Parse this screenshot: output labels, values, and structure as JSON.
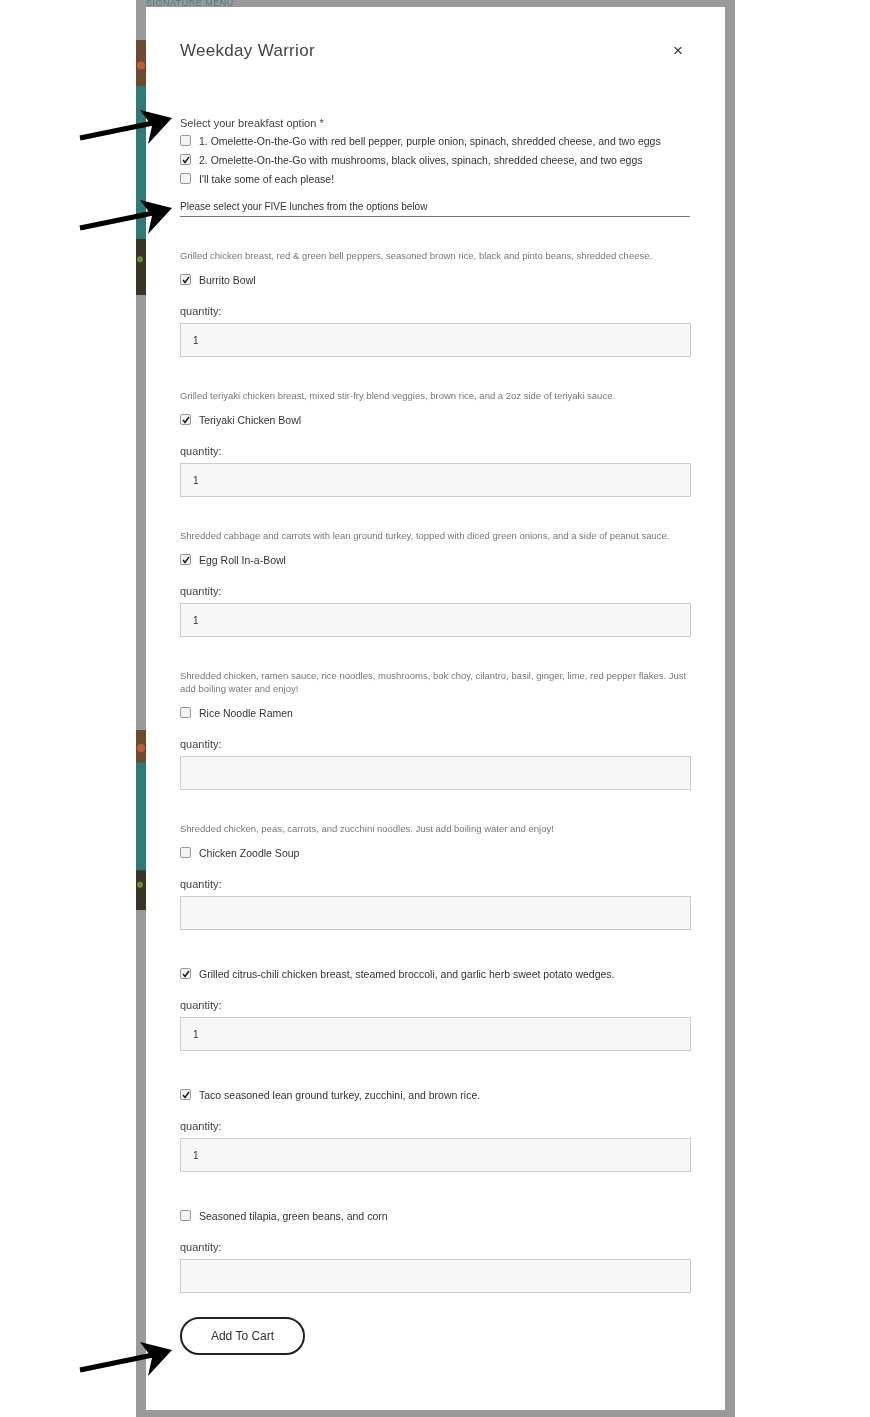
{
  "backdrop": {
    "heading": "SIGNATURE MENU"
  },
  "modal": {
    "title": "Weekday Warrior",
    "close": "×"
  },
  "breakfast": {
    "label": "Select your breakfast option *",
    "options": [
      {
        "label": "1. Omelette-On-the-Go with red bell pepper, purple onion, spinach, shredded cheese, and two eggs",
        "checked": false
      },
      {
        "label": "2. Omelette-On-the-Go with mushrooms, black olives, spinach, shredded cheese, and two eggs",
        "checked": true
      },
      {
        "label": "I'll take some of each please!",
        "checked": false
      }
    ]
  },
  "lunches": {
    "heading": "Please select your FIVE lunches from the options below",
    "items": [
      {
        "description": "Grilled chicken breast, red & green bell peppers, seasoned brown rice, black and pinto beans, shredded cheese.",
        "label": "Burrito Bowl",
        "checked": true,
        "quantity_label": "quantity:",
        "quantity": "1"
      },
      {
        "description": "Grilled teriyaki chicken breast, mixed stir-fry blend veggies, brown rice, and a 2oz side of teriyaki sauce.",
        "label": "Teriyaki Chicken Bowl",
        "checked": true,
        "quantity_label": "quantity:",
        "quantity": "1"
      },
      {
        "description": "Shredded cabbage and carrots with lean ground turkey, topped with diced green onions, and a side of peanut sauce.",
        "label": "Egg Roll In-a-Bowl",
        "checked": true,
        "quantity_label": "quantity:",
        "quantity": "1"
      },
      {
        "description": "Shredded chicken, ramen sauce, rice noodles, mushrooms, bok choy, cilantro, basil, ginger, lime, red pepper flakes. Just add boiling water and enjoy!",
        "label": "Rice Noodle Ramen",
        "checked": false,
        "quantity_label": "quantity:"
      },
      {
        "description": "Shredded chicken, peas, carrots, and zucchini noodles. Just add boiling water and enjoy!",
        "label": "Chicken Zoodle Soup",
        "checked": false,
        "quantity_label": "quantity:"
      },
      {
        "label": "Grilled citrus-chili chicken breast, steamed broccoli, and garlic herb sweet potato wedges.",
        "checked": true,
        "quantity_label": "quantity:",
        "quantity": "1"
      },
      {
        "label": "Taco seasoned lean ground turkey, zucchini, and brown rice.",
        "checked": true,
        "quantity_label": "quantity:",
        "quantity": "1"
      },
      {
        "label": "Seasoned tilapia, green beans, and corn",
        "checked": false,
        "quantity_label": "quantity:"
      }
    ]
  },
  "add_to_cart": "Add To Cart"
}
